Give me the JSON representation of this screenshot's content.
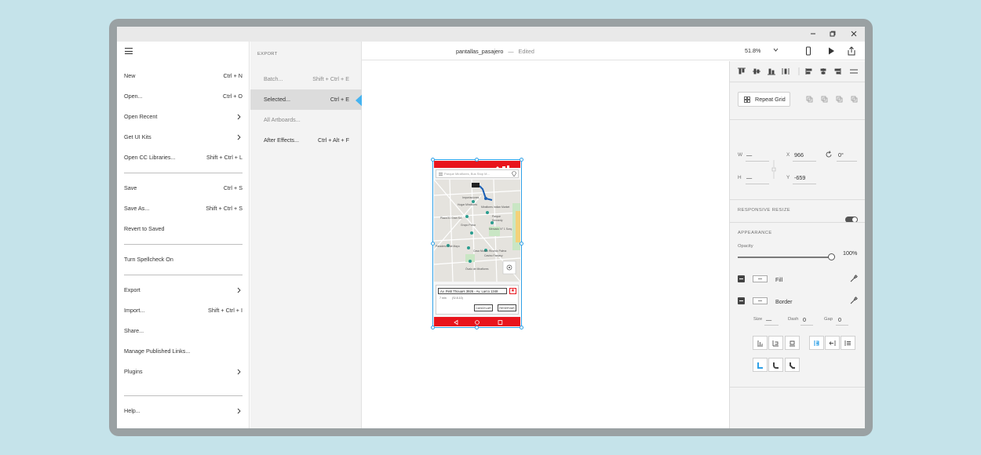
{
  "window": {
    "title": "pantallas_pasajero",
    "status": "Edited",
    "separator": "—",
    "zoom": "51.8%"
  },
  "menu": {
    "items": [
      {
        "label": "New",
        "shortcut": "Ctrl + N"
      },
      {
        "label": "Open...",
        "shortcut": "Ctrl + O"
      },
      {
        "label": "Open Recent",
        "shortcut": ""
      },
      {
        "label": "Get UI Kits",
        "shortcut": ""
      },
      {
        "label": "Open CC Libraries...",
        "shortcut": "Shift + Ctrl + L"
      },
      {
        "label": "Save",
        "shortcut": "Ctrl + S"
      },
      {
        "label": "Save As...",
        "shortcut": "Shift + Ctrl + S"
      },
      {
        "label": "Revert to Saved",
        "shortcut": ""
      },
      {
        "label": "Turn Spellcheck On",
        "shortcut": ""
      },
      {
        "label": "Export",
        "shortcut": ""
      },
      {
        "label": "Import...",
        "shortcut": "Shift + Ctrl + I"
      },
      {
        "label": "Share...",
        "shortcut": ""
      },
      {
        "label": "Manage Published Links...",
        "shortcut": ""
      },
      {
        "label": "Plugins",
        "shortcut": ""
      },
      {
        "label": "Help...",
        "shortcut": ""
      }
    ]
  },
  "export_menu": {
    "header": "EXPORT",
    "items": [
      {
        "label": "Batch...",
        "shortcut": "Shift + Ctrl + E"
      },
      {
        "label": "Selected...",
        "shortcut": "Ctrl + E"
      },
      {
        "label": "All Artboards...",
        "shortcut": ""
      },
      {
        "label": "After Effects...",
        "shortcut": "Ctrl + Alt + F"
      }
    ]
  },
  "artboard": {
    "search_placeholder": "Parque Miraflores, Bus Stop M...",
    "address": "Av. Petit Thouars 3926 - Av. Larco 1348",
    "distance": "7 min",
    "price": "(S/.8.10)",
    "cancel": "CANCELAR",
    "reserve": "RESERVAR",
    "map_labels": [
      "Importaciones",
      "Hogar Miraflores",
      "Miraflores Indian Market",
      "Plaza 51 Gran Sol",
      "Parque",
      "Kennedy",
      "Grupo Polsa",
      "Mercado N° 1 Surq.",
      "Paradero 2 de Mayo",
      "Casa Museo Ricardo Palma",
      "Casino Fantasy",
      "Óvalo de Miraflores"
    ]
  },
  "properties": {
    "repeat_grid": "Repeat Grid",
    "w_label": "W",
    "w_value": "—",
    "h_label": "H",
    "h_value": "—",
    "x_label": "X",
    "x_value": "966",
    "y_label": "Y",
    "y_value": "-659",
    "rotation": "0°",
    "responsive_resize": "RESPONSIVE RESIZE",
    "appearance": "APPEARANCE",
    "opacity_label": "Opacity",
    "opacity_value": "100%",
    "fill": "Fill",
    "border": "Border",
    "size_label": "Size",
    "size_value": "—",
    "dash_label": "Dash",
    "dash_value": "0",
    "gap_label": "Gap",
    "gap_value": "0"
  },
  "colors": {
    "accent": "#2fa0e6",
    "arrow": "#45b3f0",
    "app_red": "#e8141c"
  }
}
